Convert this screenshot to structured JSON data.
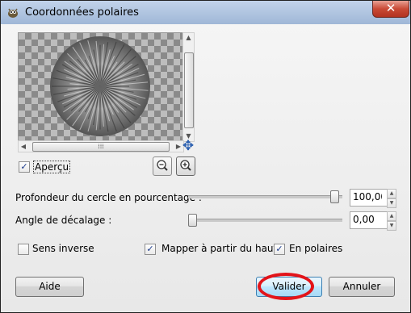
{
  "window": {
    "title": "Coordonnées polaires",
    "close_label": "✕"
  },
  "preview": {
    "checkbox_label_prefix": "",
    "checkbox_label": "Aperçu",
    "checked": true
  },
  "params": {
    "depth_label": "Profondeur du cercle en pourcentage :",
    "depth_value": "100,00",
    "depth_fraction": 1.0,
    "angle_label": "Angle de décalage :",
    "angle_value": "0,00",
    "angle_fraction": 0.0
  },
  "options": {
    "inverse_label": "Sens inverse",
    "inverse_checked": false,
    "map_top_label": "Mapper à partir du haut",
    "map_top_checked": true,
    "polar_label": "En polaires",
    "polar_checked": true
  },
  "buttons": {
    "help": "Aide",
    "ok": "Valider",
    "cancel": "Annuler"
  },
  "icons": {
    "app": "gimp-icon",
    "zoom_out": "zoom-out-icon",
    "zoom_in": "zoom-in-icon",
    "navigate": "move-arrows-icon"
  },
  "colors": {
    "highlight": "#e3141a"
  }
}
